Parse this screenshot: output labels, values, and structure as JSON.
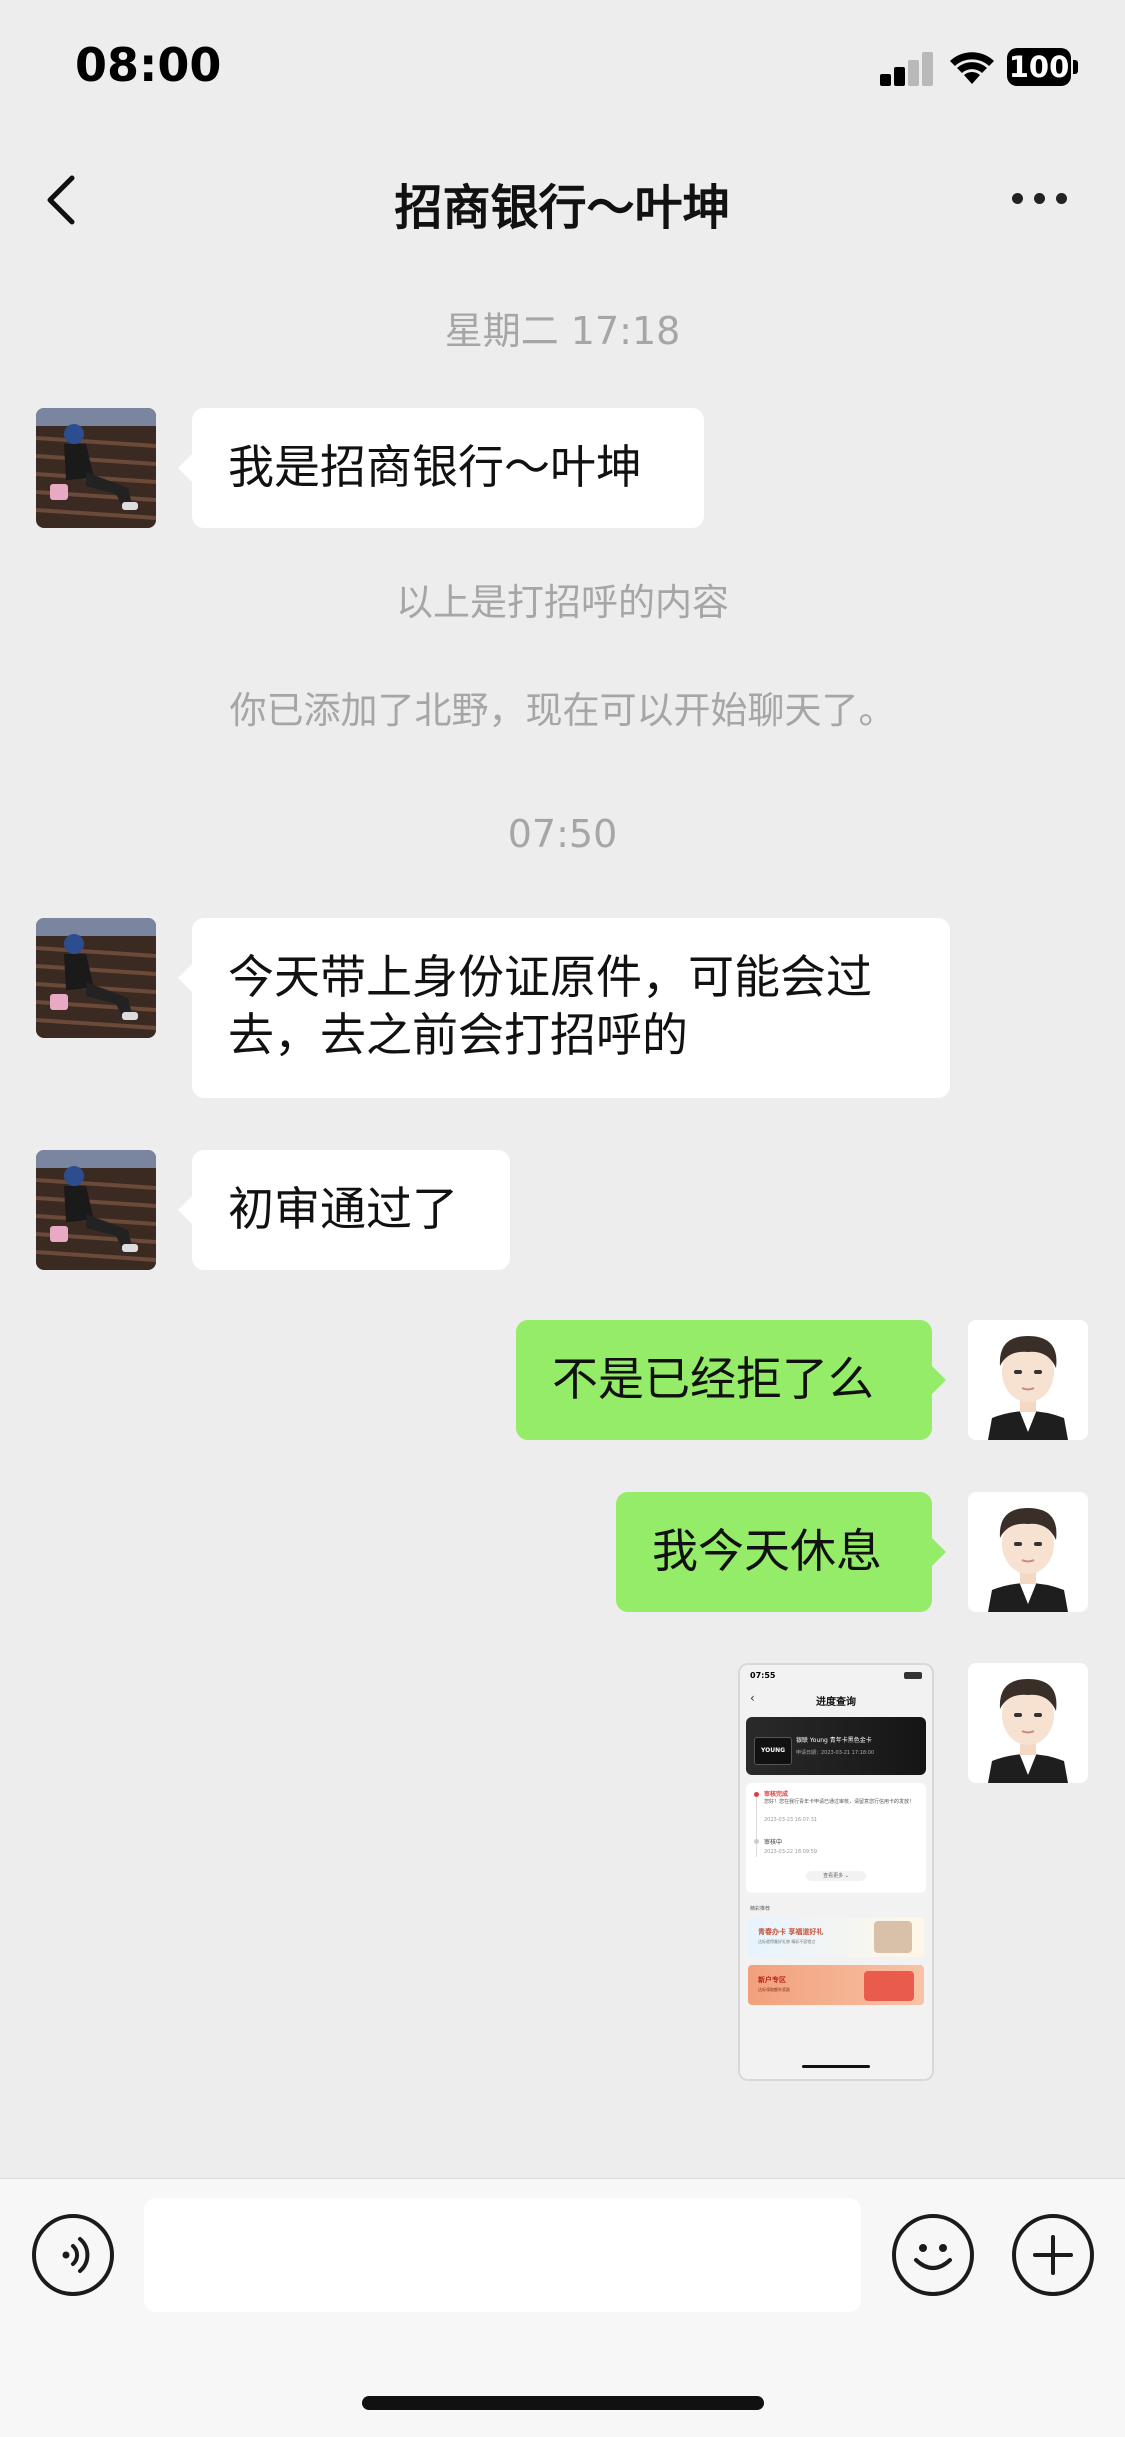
{
  "status_bar": {
    "time": "08:00",
    "battery": "100"
  },
  "nav": {
    "title": "招商银行～叶坤"
  },
  "messages": {
    "ts1": "星期二 17:18",
    "m1": "我是招商银行～叶坤",
    "sys1": "以上是打招呼的内容",
    "sys2": "你已添加了北野，现在可以开始聊天了。",
    "ts2": "07:50",
    "m2": "今天带上身份证原件，可能会过去，去之前会打招呼的",
    "m3": "初审通过了",
    "m4": "不是已经拒了么",
    "m5": "我今天休息"
  },
  "image_message": {
    "time": "07:55",
    "title": "进度查询",
    "card_name": "银联 Young 青年卡黑色金卡",
    "card_date": "申请日期：2023-03-21 17:18:00",
    "card_badge": "YOUNG",
    "step1_title": "审核完成",
    "step1_text": "您好！您在我行青年卡申请已通过审核，请留意您行信用卡的发放！",
    "step1_time": "2023-03-23 16:07:31",
    "step2_title": "审核中",
    "step2_time": "2023-03-22 18:09:59",
    "more_link": "查看更多 ⌄",
    "promo_header": "精彩推荐",
    "promo1_title": "青春办卡 享福道好礼",
    "promo1_sub": "达标就得美好礼物 精彩不容错过",
    "promo2_title": "新户专区",
    "promo2_sub": "达标领取额外奖励"
  },
  "input": {
    "placeholder": ""
  },
  "colors": {
    "background": "#ededed",
    "incoming_bubble": "#ffffff",
    "outgoing_bubble": "#95ec69",
    "system_text": "#a6a6a6"
  }
}
